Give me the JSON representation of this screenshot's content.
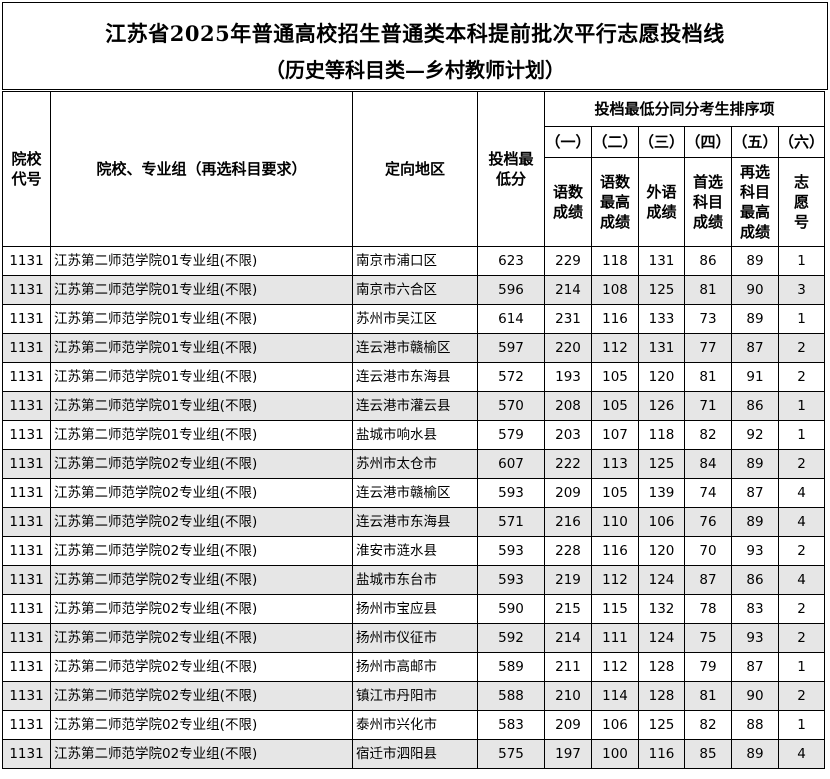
{
  "title": {
    "line1": "江苏省2025年普通高校招生普通类本科提前批次平行志愿投档线",
    "line2": "（历史等科目类—乡村教师计划）"
  },
  "headers": {
    "code": "院校代号",
    "group": "院校、专业组（再选科目要求）",
    "region": "定向地区",
    "min_score": "投档最低分",
    "tiebreak": "投档最低分同分考生排序项",
    "tie_nums": [
      "（一）",
      "（二）",
      "（三）",
      "（四）",
      "（五）",
      "（六）"
    ],
    "tie_items": [
      "语数成绩",
      "语数最高成绩",
      "外语成绩",
      "首选科目成绩",
      "再选科目最高成绩",
      "志愿号"
    ]
  },
  "rows": [
    {
      "code": "1131",
      "group": "江苏第二师范学院01专业组(不限)",
      "region": "南京市浦口区",
      "min": "623",
      "t1": "229",
      "t2": "118",
      "t3": "131",
      "t4": "86",
      "t5": "89",
      "t6": "1"
    },
    {
      "code": "1131",
      "group": "江苏第二师范学院01专业组(不限)",
      "region": "南京市六合区",
      "min": "596",
      "t1": "214",
      "t2": "108",
      "t3": "125",
      "t4": "81",
      "t5": "90",
      "t6": "3"
    },
    {
      "code": "1131",
      "group": "江苏第二师范学院01专业组(不限)",
      "region": "苏州市吴江区",
      "min": "614",
      "t1": "231",
      "t2": "116",
      "t3": "133",
      "t4": "73",
      "t5": "89",
      "t6": "1"
    },
    {
      "code": "1131",
      "group": "江苏第二师范学院01专业组(不限)",
      "region": "连云港市赣榆区",
      "min": "597",
      "t1": "220",
      "t2": "112",
      "t3": "131",
      "t4": "77",
      "t5": "87",
      "t6": "2"
    },
    {
      "code": "1131",
      "group": "江苏第二师范学院01专业组(不限)",
      "region": "连云港市东海县",
      "min": "572",
      "t1": "193",
      "t2": "105",
      "t3": "120",
      "t4": "81",
      "t5": "91",
      "t6": "2"
    },
    {
      "code": "1131",
      "group": "江苏第二师范学院01专业组(不限)",
      "region": "连云港市灌云县",
      "min": "570",
      "t1": "208",
      "t2": "105",
      "t3": "126",
      "t4": "71",
      "t5": "86",
      "t6": "1"
    },
    {
      "code": "1131",
      "group": "江苏第二师范学院01专业组(不限)",
      "region": "盐城市响水县",
      "min": "579",
      "t1": "203",
      "t2": "107",
      "t3": "118",
      "t4": "82",
      "t5": "92",
      "t6": "1"
    },
    {
      "code": "1131",
      "group": "江苏第二师范学院02专业组(不限)",
      "region": "苏州市太仓市",
      "min": "607",
      "t1": "222",
      "t2": "113",
      "t3": "125",
      "t4": "84",
      "t5": "89",
      "t6": "2"
    },
    {
      "code": "1131",
      "group": "江苏第二师范学院02专业组(不限)",
      "region": "连云港市赣榆区",
      "min": "593",
      "t1": "209",
      "t2": "105",
      "t3": "139",
      "t4": "74",
      "t5": "87",
      "t6": "4"
    },
    {
      "code": "1131",
      "group": "江苏第二师范学院02专业组(不限)",
      "region": "连云港市东海县",
      "min": "571",
      "t1": "216",
      "t2": "110",
      "t3": "106",
      "t4": "76",
      "t5": "89",
      "t6": "4"
    },
    {
      "code": "1131",
      "group": "江苏第二师范学院02专业组(不限)",
      "region": "淮安市涟水县",
      "min": "593",
      "t1": "228",
      "t2": "116",
      "t3": "120",
      "t4": "70",
      "t5": "93",
      "t6": "2"
    },
    {
      "code": "1131",
      "group": "江苏第二师范学院02专业组(不限)",
      "region": "盐城市东台市",
      "min": "593",
      "t1": "219",
      "t2": "112",
      "t3": "124",
      "t4": "87",
      "t5": "86",
      "t6": "4"
    },
    {
      "code": "1131",
      "group": "江苏第二师范学院02专业组(不限)",
      "region": "扬州市宝应县",
      "min": "590",
      "t1": "215",
      "t2": "115",
      "t3": "132",
      "t4": "78",
      "t5": "83",
      "t6": "2"
    },
    {
      "code": "1131",
      "group": "江苏第二师范学院02专业组(不限)",
      "region": "扬州市仪征市",
      "min": "592",
      "t1": "214",
      "t2": "111",
      "t3": "124",
      "t4": "75",
      "t5": "93",
      "t6": "2"
    },
    {
      "code": "1131",
      "group": "江苏第二师范学院02专业组(不限)",
      "region": "扬州市高邮市",
      "min": "589",
      "t1": "211",
      "t2": "112",
      "t3": "128",
      "t4": "79",
      "t5": "87",
      "t6": "1"
    },
    {
      "code": "1131",
      "group": "江苏第二师范学院02专业组(不限)",
      "region": "镇江市丹阳市",
      "min": "588",
      "t1": "210",
      "t2": "114",
      "t3": "128",
      "t4": "81",
      "t5": "90",
      "t6": "2"
    },
    {
      "code": "1131",
      "group": "江苏第二师范学院02专业组(不限)",
      "region": "泰州市兴化市",
      "min": "583",
      "t1": "209",
      "t2": "106",
      "t3": "125",
      "t4": "82",
      "t5": "88",
      "t6": "1"
    },
    {
      "code": "1131",
      "group": "江苏第二师范学院02专业组(不限)",
      "region": "宿迁市泗阳县",
      "min": "575",
      "t1": "197",
      "t2": "100",
      "t3": "116",
      "t4": "85",
      "t5": "89",
      "t6": "4"
    }
  ]
}
